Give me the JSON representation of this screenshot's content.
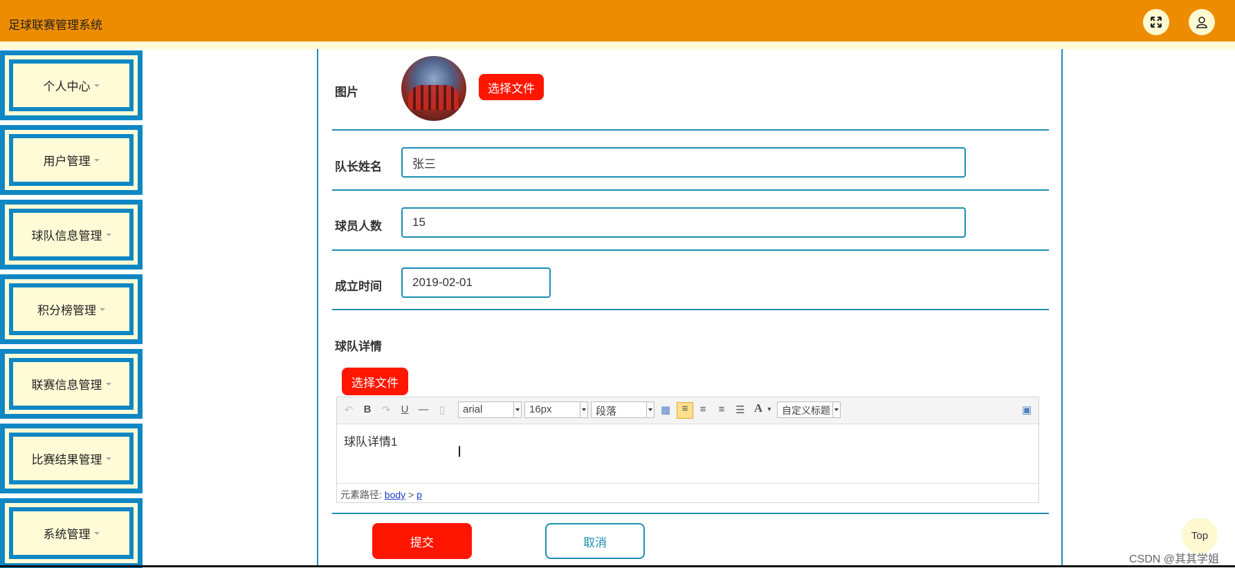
{
  "app": {
    "title": "足球联赛管理系统"
  },
  "header": {
    "fullscreen_icon": "expand-arrows-icon",
    "user_icon": "user-icon"
  },
  "sidebar": {
    "items": [
      {
        "label": "个人中心"
      },
      {
        "label": "用户管理"
      },
      {
        "label": "球队信息管理"
      },
      {
        "label": "积分榜管理"
      },
      {
        "label": "联赛信息管理"
      },
      {
        "label": "比赛结果管理"
      },
      {
        "label": "系统管理"
      }
    ]
  },
  "form": {
    "image_label": "图片",
    "choose_file_label": "选择文件",
    "captain_label": "队长姓名",
    "captain_value": "张三",
    "players_label": "球员人数",
    "players_value": "15",
    "founded_label": "成立时间",
    "founded_value": "2019-02-01",
    "details_label": "球队详情",
    "details_choose_file_label": "选择文件",
    "submit_label": "提交",
    "cancel_label": "取消"
  },
  "editor": {
    "font_family": "arial",
    "font_size": "16px",
    "paragraph": "段落",
    "custom_heading": "自定义标题",
    "content": "球队详情1",
    "path_prefix": "元素路径:",
    "path_body": "body",
    "path_sep": ">",
    "path_p": "p"
  },
  "floating": {
    "top_label": "Top"
  },
  "watermark": "CSDN @其其学姐",
  "colors": {
    "header": "#ee8c00",
    "sidebar_bg": "#fffbd6",
    "sidebar_border": "#0e87c4",
    "accent": "#1a8eb0",
    "danger": "#ff1600"
  }
}
